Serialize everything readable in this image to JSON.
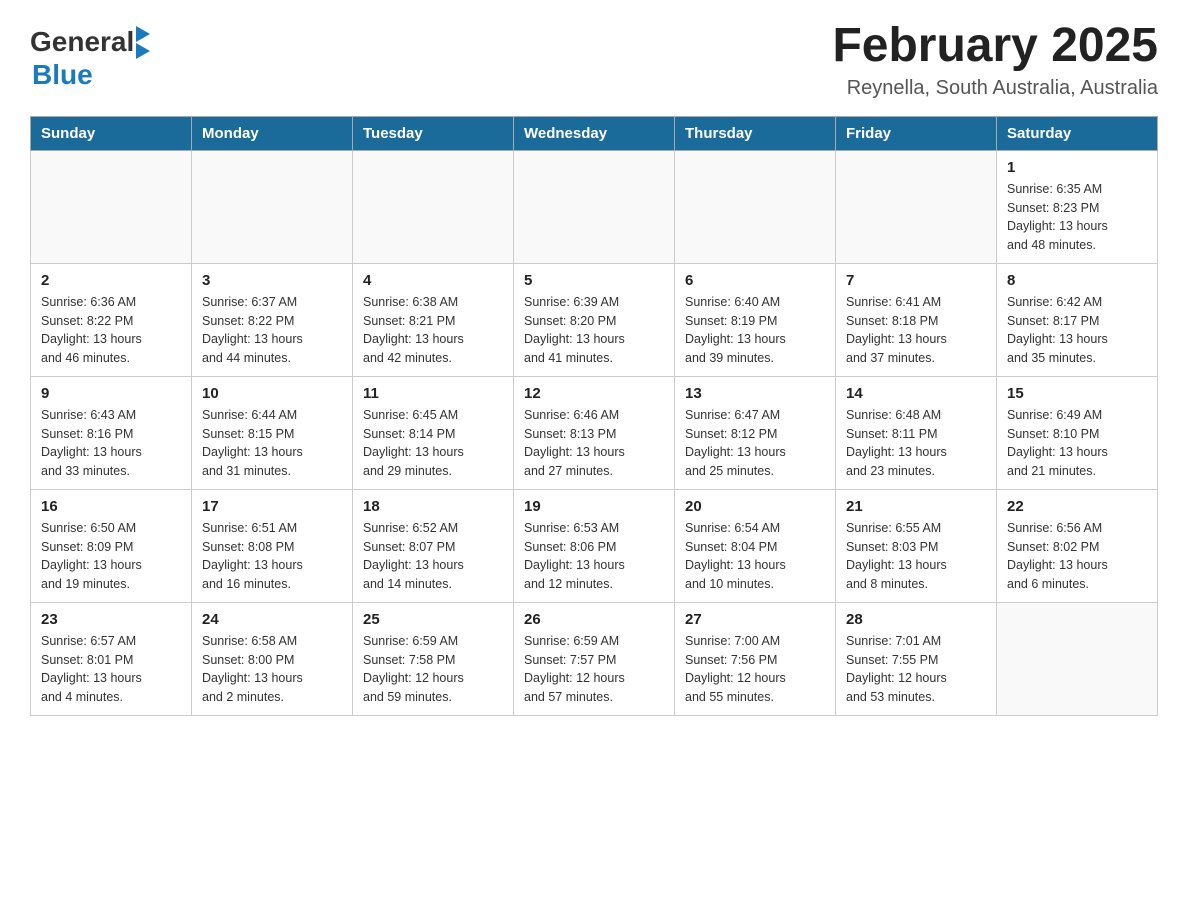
{
  "header": {
    "logo": {
      "text_general": "General",
      "text_blue": "Blue",
      "arrow_color": "#1a7abf"
    },
    "title": "February 2025",
    "subtitle": "Reynella, South Australia, Australia"
  },
  "calendar": {
    "days_of_week": [
      "Sunday",
      "Monday",
      "Tuesday",
      "Wednesday",
      "Thursday",
      "Friday",
      "Saturday"
    ],
    "weeks": [
      [
        {
          "day": "",
          "info": ""
        },
        {
          "day": "",
          "info": ""
        },
        {
          "day": "",
          "info": ""
        },
        {
          "day": "",
          "info": ""
        },
        {
          "day": "",
          "info": ""
        },
        {
          "day": "",
          "info": ""
        },
        {
          "day": "1",
          "info": "Sunrise: 6:35 AM\nSunset: 8:23 PM\nDaylight: 13 hours\nand 48 minutes."
        }
      ],
      [
        {
          "day": "2",
          "info": "Sunrise: 6:36 AM\nSunset: 8:22 PM\nDaylight: 13 hours\nand 46 minutes."
        },
        {
          "day": "3",
          "info": "Sunrise: 6:37 AM\nSunset: 8:22 PM\nDaylight: 13 hours\nand 44 minutes."
        },
        {
          "day": "4",
          "info": "Sunrise: 6:38 AM\nSunset: 8:21 PM\nDaylight: 13 hours\nand 42 minutes."
        },
        {
          "day": "5",
          "info": "Sunrise: 6:39 AM\nSunset: 8:20 PM\nDaylight: 13 hours\nand 41 minutes."
        },
        {
          "day": "6",
          "info": "Sunrise: 6:40 AM\nSunset: 8:19 PM\nDaylight: 13 hours\nand 39 minutes."
        },
        {
          "day": "7",
          "info": "Sunrise: 6:41 AM\nSunset: 8:18 PM\nDaylight: 13 hours\nand 37 minutes."
        },
        {
          "day": "8",
          "info": "Sunrise: 6:42 AM\nSunset: 8:17 PM\nDaylight: 13 hours\nand 35 minutes."
        }
      ],
      [
        {
          "day": "9",
          "info": "Sunrise: 6:43 AM\nSunset: 8:16 PM\nDaylight: 13 hours\nand 33 minutes."
        },
        {
          "day": "10",
          "info": "Sunrise: 6:44 AM\nSunset: 8:15 PM\nDaylight: 13 hours\nand 31 minutes."
        },
        {
          "day": "11",
          "info": "Sunrise: 6:45 AM\nSunset: 8:14 PM\nDaylight: 13 hours\nand 29 minutes."
        },
        {
          "day": "12",
          "info": "Sunrise: 6:46 AM\nSunset: 8:13 PM\nDaylight: 13 hours\nand 27 minutes."
        },
        {
          "day": "13",
          "info": "Sunrise: 6:47 AM\nSunset: 8:12 PM\nDaylight: 13 hours\nand 25 minutes."
        },
        {
          "day": "14",
          "info": "Sunrise: 6:48 AM\nSunset: 8:11 PM\nDaylight: 13 hours\nand 23 minutes."
        },
        {
          "day": "15",
          "info": "Sunrise: 6:49 AM\nSunset: 8:10 PM\nDaylight: 13 hours\nand 21 minutes."
        }
      ],
      [
        {
          "day": "16",
          "info": "Sunrise: 6:50 AM\nSunset: 8:09 PM\nDaylight: 13 hours\nand 19 minutes."
        },
        {
          "day": "17",
          "info": "Sunrise: 6:51 AM\nSunset: 8:08 PM\nDaylight: 13 hours\nand 16 minutes."
        },
        {
          "day": "18",
          "info": "Sunrise: 6:52 AM\nSunset: 8:07 PM\nDaylight: 13 hours\nand 14 minutes."
        },
        {
          "day": "19",
          "info": "Sunrise: 6:53 AM\nSunset: 8:06 PM\nDaylight: 13 hours\nand 12 minutes."
        },
        {
          "day": "20",
          "info": "Sunrise: 6:54 AM\nSunset: 8:04 PM\nDaylight: 13 hours\nand 10 minutes."
        },
        {
          "day": "21",
          "info": "Sunrise: 6:55 AM\nSunset: 8:03 PM\nDaylight: 13 hours\nand 8 minutes."
        },
        {
          "day": "22",
          "info": "Sunrise: 6:56 AM\nSunset: 8:02 PM\nDaylight: 13 hours\nand 6 minutes."
        }
      ],
      [
        {
          "day": "23",
          "info": "Sunrise: 6:57 AM\nSunset: 8:01 PM\nDaylight: 13 hours\nand 4 minutes."
        },
        {
          "day": "24",
          "info": "Sunrise: 6:58 AM\nSunset: 8:00 PM\nDaylight: 13 hours\nand 2 minutes."
        },
        {
          "day": "25",
          "info": "Sunrise: 6:59 AM\nSunset: 7:58 PM\nDaylight: 12 hours\nand 59 minutes."
        },
        {
          "day": "26",
          "info": "Sunrise: 6:59 AM\nSunset: 7:57 PM\nDaylight: 12 hours\nand 57 minutes."
        },
        {
          "day": "27",
          "info": "Sunrise: 7:00 AM\nSunset: 7:56 PM\nDaylight: 12 hours\nand 55 minutes."
        },
        {
          "day": "28",
          "info": "Sunrise: 7:01 AM\nSunset: 7:55 PM\nDaylight: 12 hours\nand 53 minutes."
        },
        {
          "day": "",
          "info": ""
        }
      ]
    ]
  }
}
